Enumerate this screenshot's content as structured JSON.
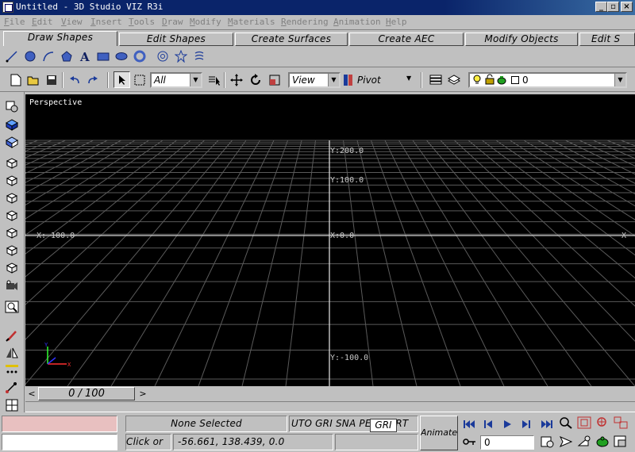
{
  "window": {
    "title": "Untitled - 3D Studio VIZ R3i"
  },
  "menu": {
    "items": [
      "File",
      "Edit",
      "View",
      "Insert",
      "Tools",
      "Draw",
      "Modify",
      "Materials",
      "Rendering",
      "Animation",
      "Help"
    ]
  },
  "tabs": {
    "items": [
      "Draw Shapes",
      "Edit Shapes",
      "Create Surfaces",
      "Create AEC",
      "Modify Objects",
      "Edit S"
    ],
    "active": "Draw Shapes"
  },
  "toolbar": {
    "selection_filter": "All",
    "reference_coord": "View",
    "pivot_label": "Pivot",
    "layer_value": "0"
  },
  "viewport": {
    "name": "Perspective",
    "grid_labels": {
      "y_200": "Y:200.0",
      "y_100": "Y:100.0",
      "x_neg_100": "X:-100.0",
      "x_0": "X:0.0",
      "x_right": "X",
      "y_neg_100": "Y:-100.0"
    },
    "axis_tripod": {
      "x_label": "X",
      "y_label": "Y",
      "x_color": "#ff3030",
      "y_color": "#3030ff",
      "z_color": "#30ff30"
    }
  },
  "time_slider": {
    "frame_label": "0 / 100",
    "prev_symbol": "<",
    "next_symbol": ">"
  },
  "status": {
    "selection": "None Selected",
    "snap_modes": "UTO GRI SNA PERC ORT",
    "snap_highlighted": "GRI",
    "prompt": "Click or",
    "coordinates": "-56.661, 138.439, 0.0",
    "animate_label": "Animate",
    "frame_field": "0"
  },
  "colors": {
    "title_bar": "#0a246a",
    "face": "#c0c0c0",
    "viewport_bg": "#000000",
    "grid": "#5a5a5a",
    "status_pink": "#e8c0c0"
  }
}
